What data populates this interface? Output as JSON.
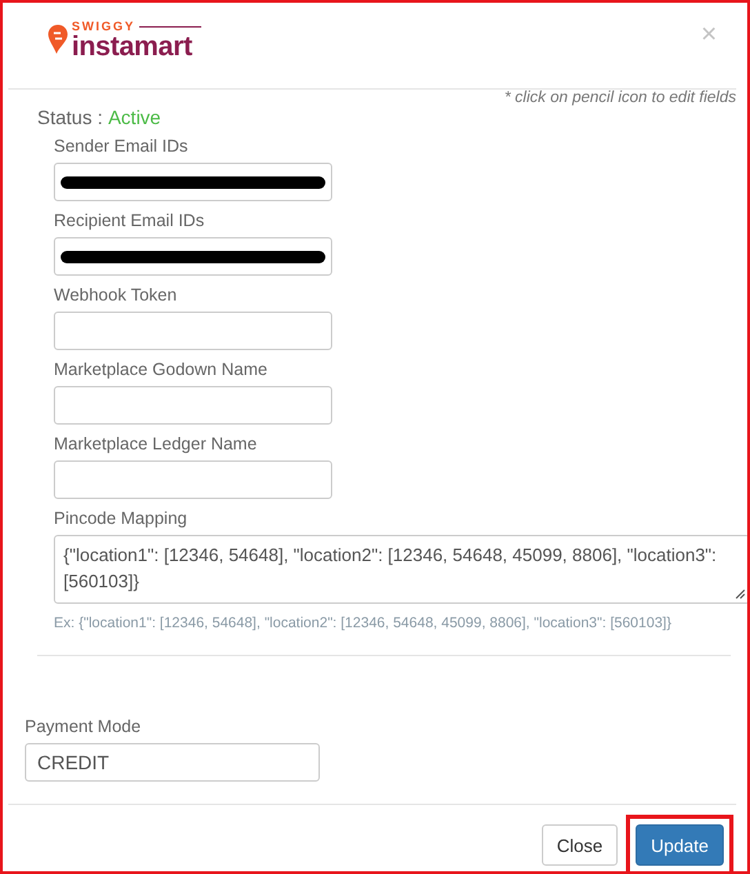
{
  "logo": {
    "brand": "SWIGGY",
    "product": "instamart"
  },
  "close_icon": "×",
  "note": "* click on pencil icon to edit fields",
  "status": {
    "label": "Status :",
    "value": "Active"
  },
  "fields": [
    {
      "kind": "input",
      "label": "Sender Email IDs",
      "redacted": true
    },
    {
      "kind": "input",
      "label": "Recipient Email IDs",
      "redacted": true
    },
    {
      "kind": "input",
      "label": "Webhook Token",
      "redacted": false
    },
    {
      "kind": "input",
      "label": "Marketplace Godown Name",
      "redacted": false
    },
    {
      "kind": "input",
      "label": "Marketplace Ledger Name",
      "redacted": false
    },
    {
      "kind": "textarea",
      "label": "Pincode Mapping",
      "value": "{\"location1\": [12346, 54648], \"location2\": [12346, 54648, 45099, 8806], \"location3\": [560103]}",
      "hint": "Ex: {\"location1\": [12346, 54648], \"location2\": [12346, 54648, 45099, 8806], \"location3\": [560103]}"
    }
  ],
  "payment_mode": {
    "label": "Payment Mode",
    "value": "CREDIT"
  },
  "buttons": [
    {
      "kind": "default",
      "label": "Close",
      "highlighted": false
    },
    {
      "kind": "primary",
      "label": "Update",
      "highlighted": true
    }
  ]
}
